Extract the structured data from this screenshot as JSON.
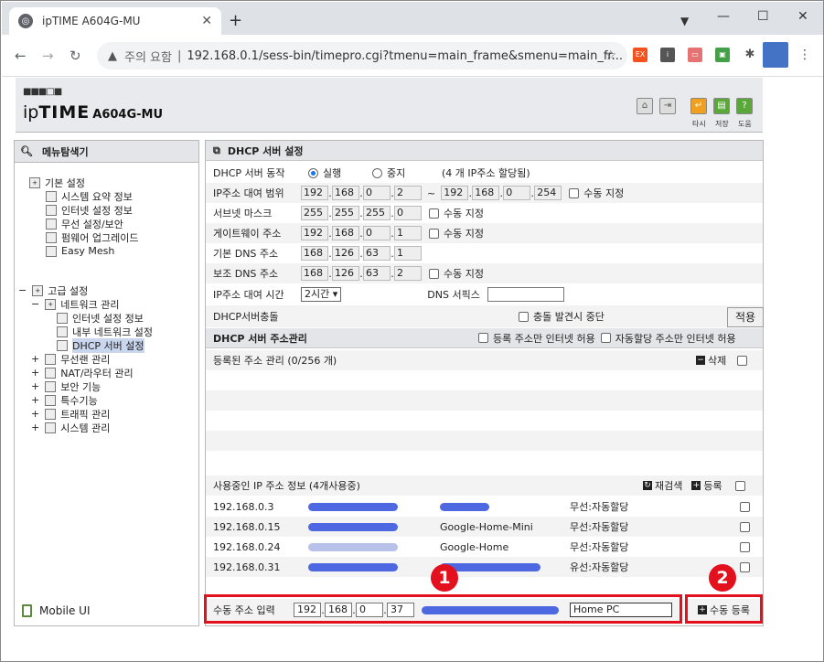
{
  "browser": {
    "tab_title": "ipTIME A604G-MU",
    "tab_favicon": "globe-icon",
    "new_tab": "+",
    "warning": "주의 요함",
    "url": "192.168.0.1/sess-bin/timepro.cgi?tmenu=main_frame&smenu=main_fr...",
    "ext_ex": "EX"
  },
  "header": {
    "brand_dots": "■■■□■",
    "brand_ip": "ip",
    "brand_time": "TIME",
    "model": "A604G-MU",
    "labels": [
      "타시",
      "저장",
      "도움"
    ]
  },
  "sidebar": {
    "title": "메뉴탐색기",
    "basic": "기본 설정",
    "basic_items": [
      "시스템 요약 정보",
      "인터넷 설정 정보",
      "무선 설정/보안",
      "펌웨어 업그레이드",
      "Easy Mesh"
    ],
    "advanced": "고급 설정",
    "network": "네트워크 관리",
    "network_items": [
      "인터넷 설정 정보",
      "내부 네트워크 설정",
      "DHCP 서버 설정"
    ],
    "other_items": [
      "무선랜 관리",
      "NAT/라우터 관리",
      "보안 기능",
      "특수기능",
      "트래픽 관리",
      "시스템 관리"
    ],
    "mobile": "Mobile UI"
  },
  "dhcp": {
    "title": "DHCP 서버 설정",
    "op_label": "DHCP 서버 동작",
    "run": "실행",
    "stop": "중지",
    "alloc_note": "(4 개 IP주소 할당됨)",
    "range_label": "IP주소 대여 범위",
    "range_start": [
      "192",
      "168",
      "0",
      "2"
    ],
    "tilde": "~",
    "range_end": [
      "192",
      "168",
      "0",
      "254"
    ],
    "manual": "수동 지정",
    "subnet_label": "서브넷 마스크",
    "subnet": [
      "255",
      "255",
      "255",
      "0"
    ],
    "gateway_label": "게이트웨이 주소",
    "gateway": [
      "192",
      "168",
      "0",
      "1"
    ],
    "dns1_label": "기본 DNS 주소",
    "dns1": [
      "168",
      "126",
      "63",
      "1"
    ],
    "dns2_label": "보조 DNS 주소",
    "dns2": [
      "168",
      "126",
      "63",
      "2"
    ],
    "lease_label": "IP주소 대여 시간",
    "lease_value": "2시간",
    "dns_suffix": "DNS 서픽스",
    "conflict_label": "DHCP서버충돌",
    "conflict_stop": "충돌 발견시 중단",
    "apply": "적용"
  },
  "addr": {
    "title": "DHCP 서버 주소관리",
    "reg_only": "등록 주소만 인터넷 허용",
    "auto_only": "자동할당 주소만 인터넷 허용",
    "registered": "등록된 주소 관리 (0/256 개)",
    "delete": "삭제",
    "inuse": "사용중인 IP 주소 정보 (4개사용중)",
    "rescan": "재검색",
    "register": "등록",
    "rows": [
      {
        "ip": "192.168.0.3",
        "name": "",
        "type": "무선:자동할당"
      },
      {
        "ip": "192.168.0.15",
        "name": "Google-Home-Mini",
        "type": "무선:자동할당"
      },
      {
        "ip": "192.168.0.24",
        "name": "Google-Home",
        "type": "무선:자동할당"
      },
      {
        "ip": "192.168.0.31",
        "name": "",
        "type": "유선:자동할당"
      }
    ],
    "manual_label": "수동 주소 입력",
    "manual_ip": [
      "192",
      "168",
      "0",
      "37"
    ],
    "manual_name": "Home PC",
    "manual_register": "수동 등록"
  },
  "annotations": {
    "one": "1",
    "two": "2"
  }
}
